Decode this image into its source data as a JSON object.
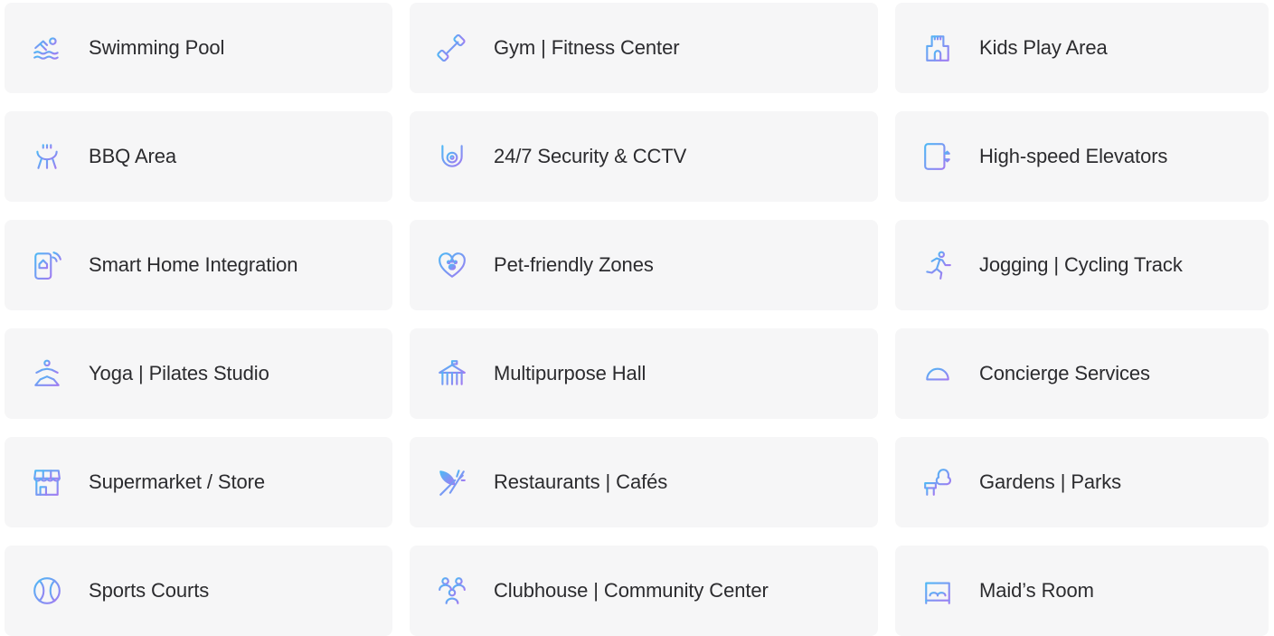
{
  "amenities": [
    {
      "label": "Swimming Pool",
      "icon": "swimming-pool-icon"
    },
    {
      "label": "Gym | Fitness Center",
      "icon": "dumbbell-icon"
    },
    {
      "label": "Kids Play Area",
      "icon": "castle-icon"
    },
    {
      "label": "BBQ Area",
      "icon": "grill-icon"
    },
    {
      "label": "24/7 Security & CCTV",
      "icon": "cctv-camera-icon"
    },
    {
      "label": "High-speed Elevators",
      "icon": "elevator-icon"
    },
    {
      "label": "Smart Home Integration",
      "icon": "smart-phone-home-icon"
    },
    {
      "label": "Pet-friendly Zones",
      "icon": "paw-heart-icon"
    },
    {
      "label": "Jogging | Cycling Track",
      "icon": "running-person-icon"
    },
    {
      "label": "Yoga | Pilates Studio",
      "icon": "yoga-person-icon"
    },
    {
      "label": "Multipurpose Hall",
      "icon": "hall-building-icon"
    },
    {
      "label": "Concierge Services",
      "icon": "service-bell-icon"
    },
    {
      "label": "Supermarket / Store",
      "icon": "store-icon"
    },
    {
      "label": "Restaurants | Cafés",
      "icon": "fork-leaf-icon"
    },
    {
      "label": "Gardens | Parks",
      "icon": "bench-tree-icon"
    },
    {
      "label": "Sports Courts",
      "icon": "tennis-ball-icon"
    },
    {
      "label": "Clubhouse | Community Center",
      "icon": "community-people-icon"
    },
    {
      "label": "Maid’s Room",
      "icon": "bed-icon"
    }
  ],
  "colors": {
    "card_background": "#f6f6f7",
    "text": "#2b2b2e",
    "icon_gradient_start": "#4fb8f5",
    "icon_gradient_end": "#a07cf2"
  }
}
